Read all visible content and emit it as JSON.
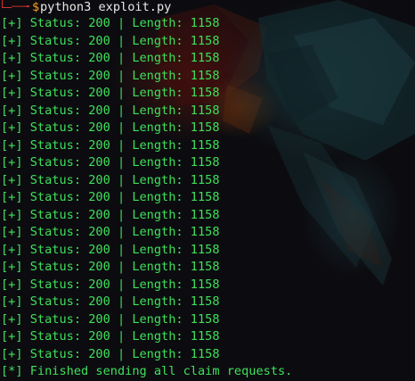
{
  "terminal": {
    "prompt": {
      "arrow": "──╼",
      "dollar": "$",
      "command": "python3 exploit.py"
    },
    "output_lines": [
      "[+] Status: 200 | Length: 1158",
      "[+] Status: 200 | Length: 1158",
      "[+] Status: 200 | Length: 1158",
      "[+] Status: 200 | Length: 1158",
      "[+] Status: 200 | Length: 1158",
      "[+] Status: 200 | Length: 1158",
      "[+] Status: 200 | Length: 1158",
      "[+] Status: 200 | Length: 1158",
      "[+] Status: 200 | Length: 1158",
      "[+] Status: 200 | Length: 1158",
      "[+] Status: 200 | Length: 1158",
      "[+] Status: 200 | Length: 1158",
      "[+] Status: 200 | Length: 1158",
      "[+] Status: 200 | Length: 1158",
      "[+] Status: 200 | Length: 1158",
      "[+] Status: 200 | Length: 1158",
      "[+] Status: 200 | Length: 1158",
      "[+] Status: 200 | Length: 1158",
      "[+] Status: 200 | Length: 1158",
      "[+] Status: 200 | Length: 1158"
    ],
    "final_line": "[*] Finished sending all claim requests."
  },
  "colors": {
    "background": "#0c0c10",
    "output_text": "#3fe05a",
    "prompt_frame": "#d0342c",
    "prompt_dollar": "#ff9e1b",
    "command_text": "#e8e8e8"
  },
  "wallpaper": {
    "subject": "parrot-icon"
  }
}
